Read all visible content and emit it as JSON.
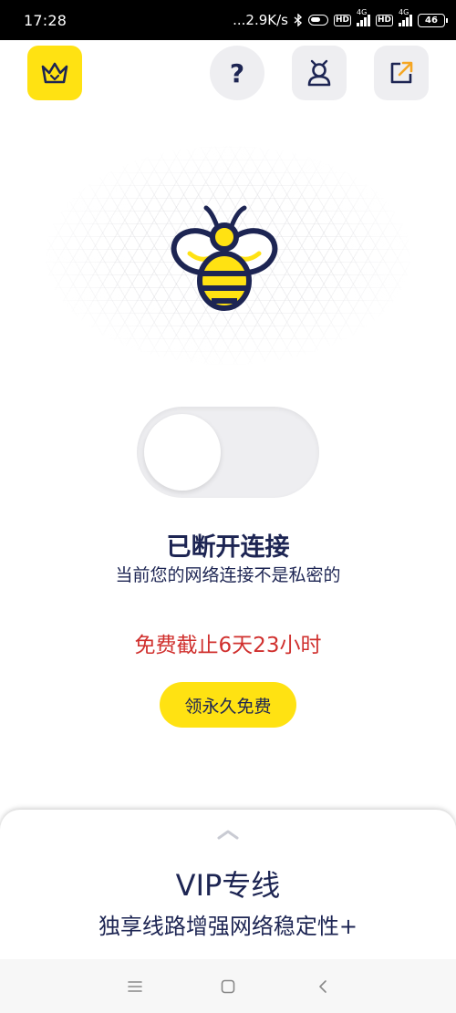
{
  "status_bar": {
    "time": "17:28",
    "speed": "...2.9K/s",
    "hd1": "HD",
    "net1": "4G",
    "hd2": "HD",
    "net2": "4G",
    "battery": "46"
  },
  "top_bar": {
    "crown_icon": "crown-icon",
    "help_label": "?",
    "profile_icon": "user-icon",
    "share_icon": "share-icon"
  },
  "connection": {
    "title": "已断开连接",
    "subtitle": "当前您的网络连接不是私密的",
    "free_until": "免费截止6天23小时",
    "cta_label": "领永久免费",
    "toggle_on": false
  },
  "vip_sheet": {
    "title": "VIP专线",
    "subtitle": "独享线路增强网络稳定性+"
  },
  "colors": {
    "accent_yellow": "#FFE212",
    "navy": "#1D2553",
    "alert_red": "#D0302E",
    "button_gray": "#EEEEF1"
  },
  "nav": {
    "menu_icon": "menu-icon",
    "home_icon": "home-icon",
    "back_icon": "back-icon"
  }
}
